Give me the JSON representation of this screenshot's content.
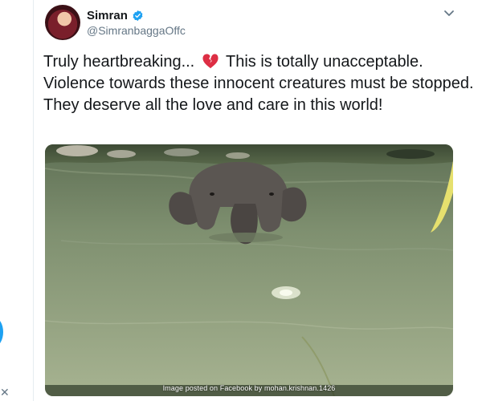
{
  "tweet": {
    "author_name": "Simran",
    "author_handle": "@SimranbaggaOffc",
    "text_part1": "Truly heartbreaking...",
    "text_part2": "This is totally unacceptable. Violence towards these innocent creatures must be stopped. They deserve all the love and care in this world!",
    "media_caption": "Image posted on Facebook by mohan.krishnan.1426"
  },
  "icons": {
    "verified": "verified-badge-icon",
    "menu": "chevron-down-icon",
    "emoji": "broken-heart-icon",
    "side": "close-icon"
  },
  "side": {
    "close_glyph": "✕"
  },
  "colors": {
    "verified": "#1da1f2",
    "handle": "#657786",
    "text": "#14171a",
    "broken_heart": "#dd2e44"
  }
}
